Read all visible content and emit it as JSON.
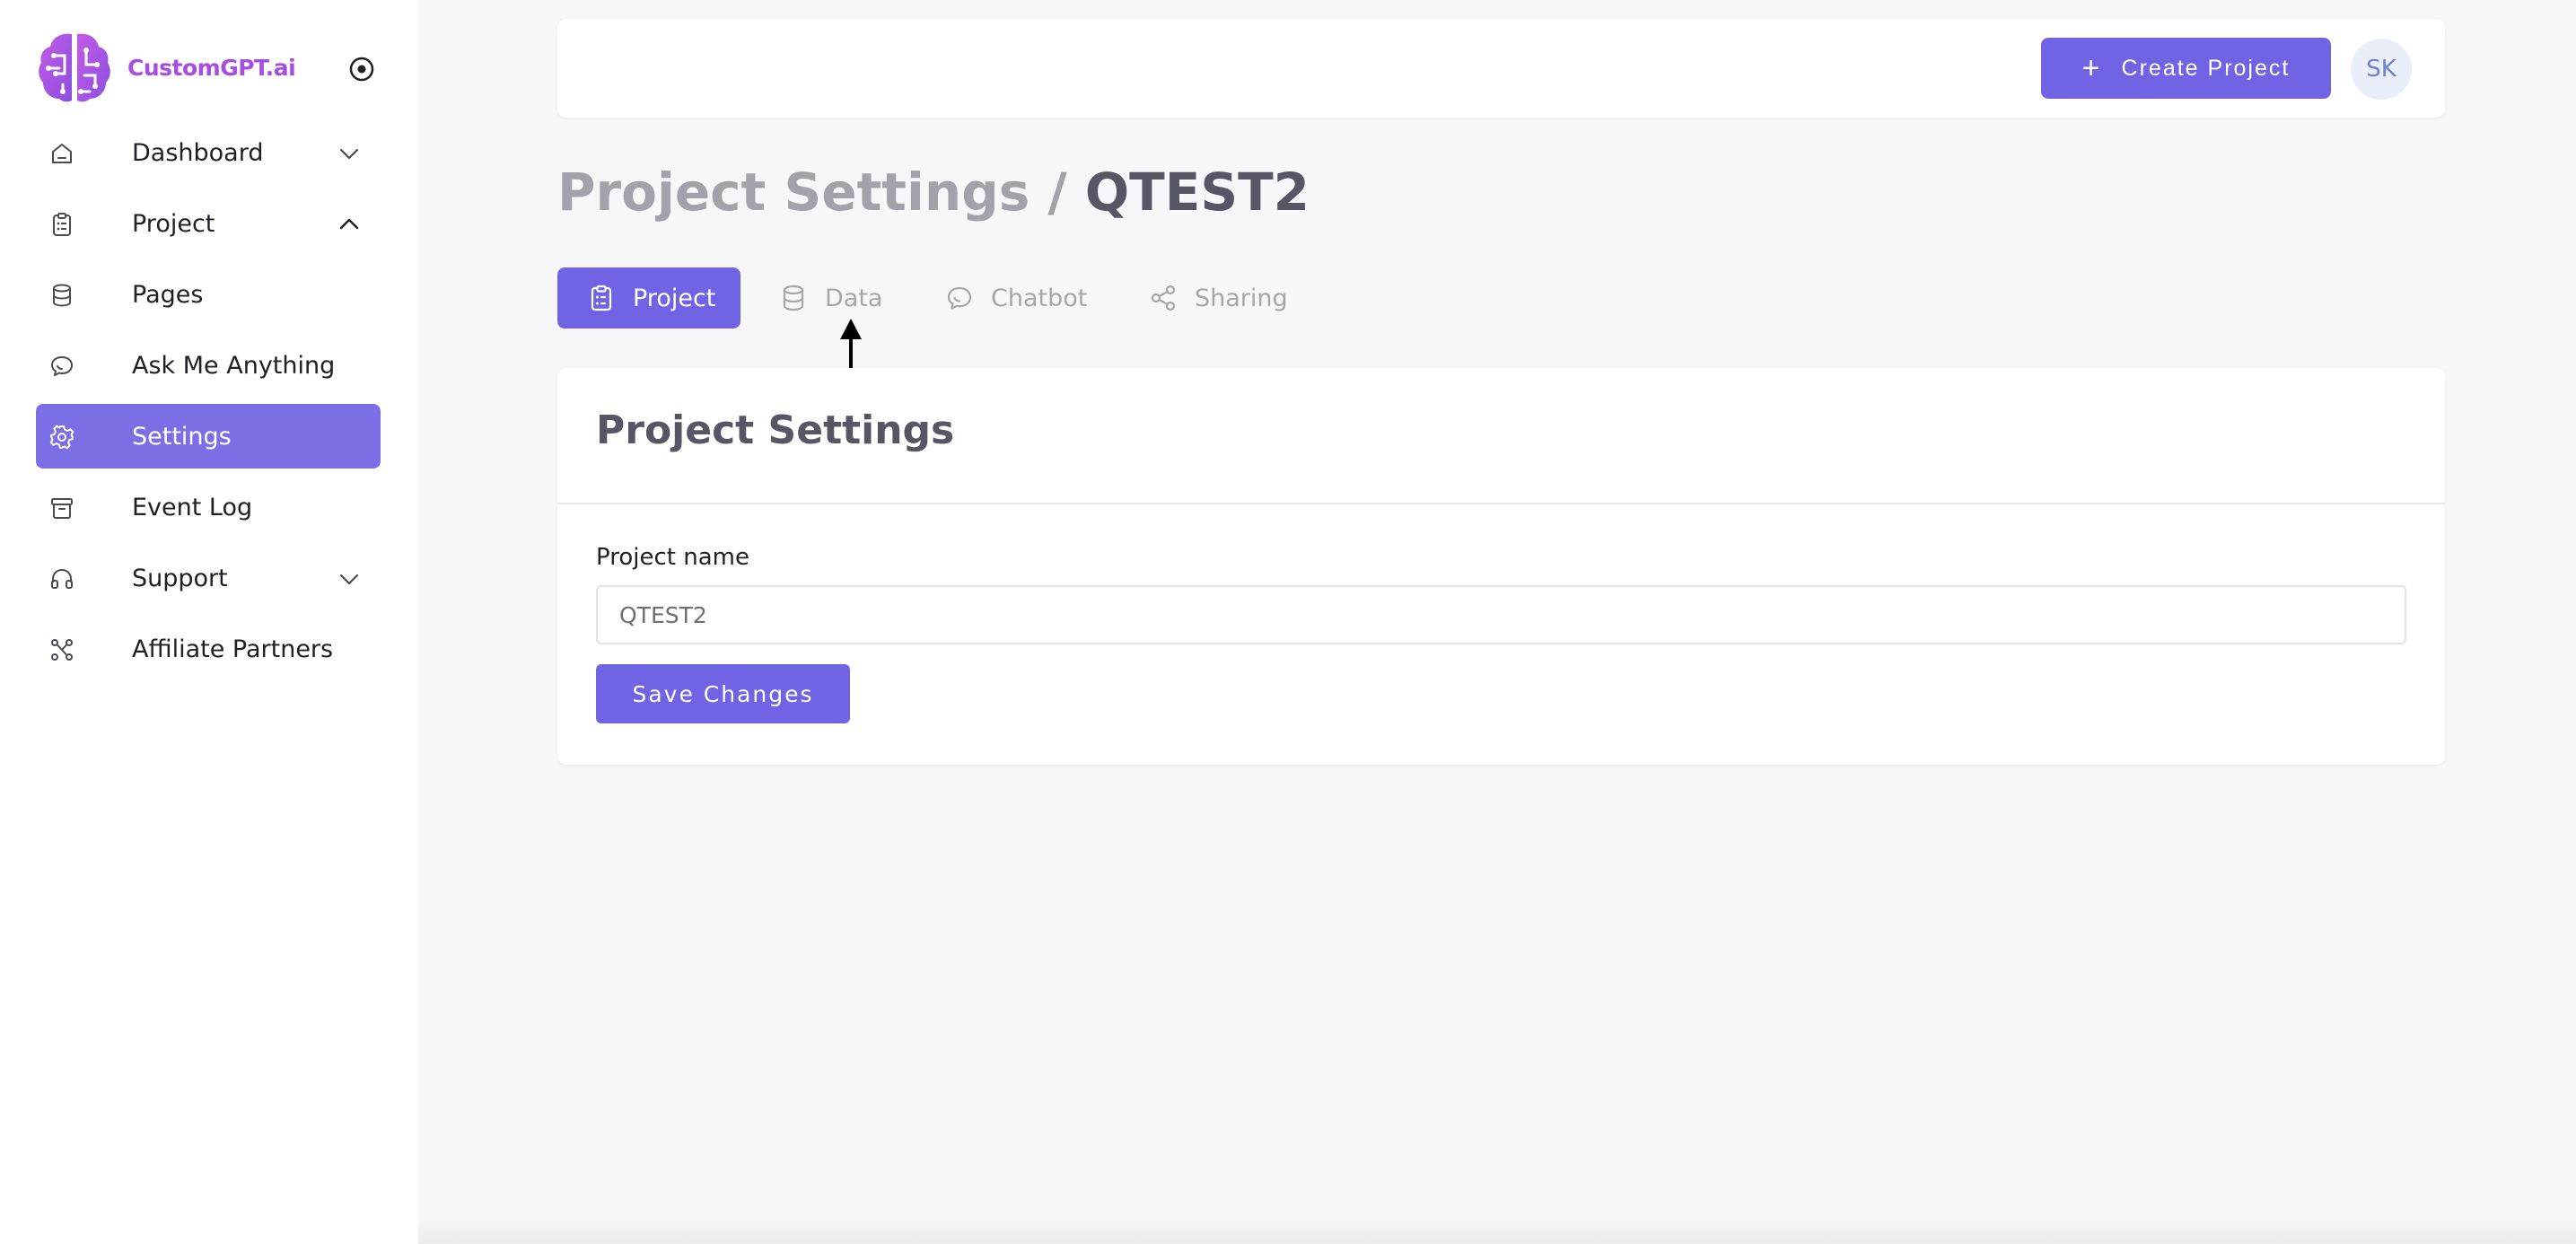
{
  "brand": {
    "name": "CustomGPT.ai",
    "accent": "#a64ee0"
  },
  "sidebar": {
    "items": [
      {
        "label": "Dashboard",
        "icon": "home-icon",
        "chevron": "down"
      },
      {
        "label": "Project",
        "icon": "clipboard-icon",
        "chevron": "up"
      },
      {
        "label": "Pages",
        "icon": "database-icon"
      },
      {
        "label": "Ask Me Anything",
        "icon": "chat-icon"
      },
      {
        "label": "Settings",
        "icon": "gear-icon",
        "active": true
      },
      {
        "label": "Event Log",
        "icon": "archive-icon"
      },
      {
        "label": "Support",
        "icon": "headphones-icon",
        "chevron": "down"
      },
      {
        "label": "Affiliate Partners",
        "icon": "affiliate-icon"
      }
    ]
  },
  "header": {
    "create_label": "Create Project",
    "avatar_initials": "SK"
  },
  "page": {
    "crumb": "Project Settings",
    "separator": " / ",
    "current": "QTEST2"
  },
  "tabs": [
    {
      "label": "Project",
      "icon": "clipboard-icon",
      "active": true
    },
    {
      "label": "Data",
      "icon": "database-icon"
    },
    {
      "label": "Chatbot",
      "icon": "chat-icon"
    },
    {
      "label": "Sharing",
      "icon": "share-icon"
    }
  ],
  "card": {
    "title": "Project Settings",
    "field_label": "Project name",
    "field_value": "QTEST2",
    "save_label": "Save Changes"
  },
  "colors": {
    "primary": "#7064e5",
    "sidebar_active": "#7c6fe6",
    "background": "#f7f7f9"
  }
}
